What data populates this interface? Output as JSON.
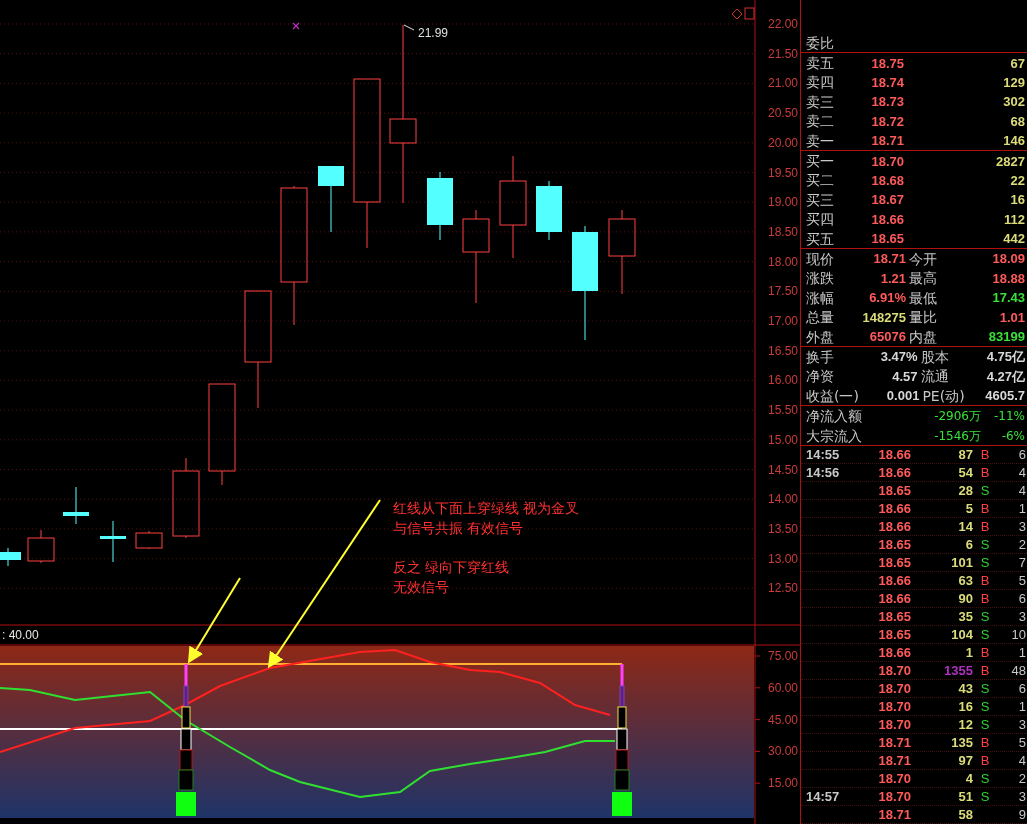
{
  "chart": {
    "high_label": "21.99",
    "price_axis": [
      "22.00",
      "21.50",
      "21.00",
      "20.50",
      "20.00",
      "19.50",
      "19.00",
      "18.50",
      "18.00",
      "17.50",
      "17.00",
      "16.50",
      "16.00",
      "15.50",
      "15.00",
      "14.50",
      "14.00",
      "13.50",
      "13.00",
      "12.50"
    ],
    "annotation": [
      "红线从下面上穿绿线 视为金叉",
      "与信号共振  有效信号",
      "反之 绿向下穿红线",
      "无效信号"
    ]
  },
  "indicator": {
    "header": ": 40.00",
    "axis": [
      "75.00",
      "60.00",
      "45.00",
      "30.00",
      "15.00"
    ]
  },
  "quote": {
    "ratio_label": "委比",
    "asks": [
      {
        "label": "卖五",
        "price": "18.75",
        "volume": "67"
      },
      {
        "label": "卖四",
        "price": "18.74",
        "volume": "129"
      },
      {
        "label": "卖三",
        "price": "18.73",
        "volume": "302"
      },
      {
        "label": "卖二",
        "price": "18.72",
        "volume": "68"
      },
      {
        "label": "卖一",
        "price": "18.71",
        "volume": "146"
      }
    ],
    "bids": [
      {
        "label": "买一",
        "price": "18.70",
        "volume": "2827"
      },
      {
        "label": "买二",
        "price": "18.68",
        "volume": "22"
      },
      {
        "label": "买三",
        "price": "18.67",
        "volume": "16"
      },
      {
        "label": "买四",
        "price": "18.66",
        "volume": "112"
      },
      {
        "label": "买五",
        "price": "18.65",
        "volume": "442"
      }
    ],
    "stats": [
      [
        {
          "label": "现价",
          "value": "18.71",
          "color": "#ff5a5a"
        },
        {
          "label": "今开",
          "value": "18.09",
          "color": "#ff5a5a"
        }
      ],
      [
        {
          "label": "涨跌",
          "value": "1.21",
          "color": "#ff5a5a"
        },
        {
          "label": "最高",
          "value": "18.88",
          "color": "#ff5a5a"
        }
      ],
      [
        {
          "label": "涨幅",
          "value": "6.91%",
          "color": "#ff5a5a"
        },
        {
          "label": "最低",
          "value": "17.43",
          "color": "#3ae03a"
        }
      ],
      [
        {
          "label": "总量",
          "value": "148275",
          "color": "#dcdc7a"
        },
        {
          "label": "量比",
          "value": "1.01",
          "color": "#ff5a5a"
        }
      ],
      [
        {
          "label": "外盘",
          "value": "65076",
          "color": "#ff5a5a"
        },
        {
          "label": "内盘",
          "value": "83199",
          "color": "#3ae03a"
        }
      ]
    ],
    "finance": [
      [
        {
          "label": "换手",
          "value": "3.47%"
        },
        {
          "label": "股本",
          "value": "4.75亿"
        }
      ],
      [
        {
          "label": "净资",
          "value": "4.57"
        },
        {
          "label": "流通",
          "value": "4.27亿"
        }
      ],
      [
        {
          "label": "收益(一)",
          "value": "0.001"
        },
        {
          "label": "PE(动)",
          "value": "4605.7"
        }
      ]
    ],
    "flows": [
      {
        "label": "净流入额",
        "amount": "-2906万",
        "percent": "-11%"
      },
      {
        "label": "大宗流入",
        "amount": "-1546万",
        "percent": "-6%"
      }
    ]
  },
  "trades": [
    {
      "time": "14:55",
      "price": "18.66",
      "volume": "87",
      "side": "B",
      "kind": "buy",
      "count": "6",
      "highlight": false
    },
    {
      "time": "14:56",
      "price": "18.66",
      "volume": "54",
      "side": "B",
      "kind": "buy",
      "count": "4",
      "highlight": false
    },
    {
      "price": "18.65",
      "volume": "28",
      "side": "S",
      "kind": "sell",
      "count": "4",
      "highlight": false
    },
    {
      "price": "18.66",
      "volume": "5",
      "side": "B",
      "kind": "buy",
      "count": "1",
      "highlight": false
    },
    {
      "price": "18.66",
      "volume": "14",
      "side": "B",
      "kind": "buy",
      "count": "3",
      "highlight": false
    },
    {
      "price": "18.65",
      "volume": "6",
      "side": "S",
      "kind": "sell",
      "count": "2",
      "highlight": false
    },
    {
      "price": "18.65",
      "volume": "101",
      "side": "S",
      "kind": "sell",
      "count": "7",
      "highlight": false
    },
    {
      "price": "18.66",
      "volume": "63",
      "side": "B",
      "kind": "buy",
      "count": "5",
      "highlight": false
    },
    {
      "price": "18.66",
      "volume": "90",
      "side": "B",
      "kind": "buy",
      "count": "6",
      "highlight": false
    },
    {
      "price": "18.65",
      "volume": "35",
      "side": "S",
      "kind": "sell",
      "count": "3",
      "highlight": false
    },
    {
      "price": "18.65",
      "volume": "104",
      "side": "S",
      "kind": "sell",
      "count": "10",
      "highlight": false
    },
    {
      "price": "18.66",
      "volume": "1",
      "side": "B",
      "kind": "buy",
      "count": "1",
      "highlight": false
    },
    {
      "price": "18.70",
      "volume": "1355",
      "side": "B",
      "kind": "buy",
      "count": "48",
      "highlight": true
    },
    {
      "price": "18.70",
      "volume": "43",
      "side": "S",
      "kind": "sell",
      "count": "6",
      "highlight": false
    },
    {
      "price": "18.70",
      "volume": "16",
      "side": "S",
      "kind": "sell",
      "count": "1",
      "highlight": false
    },
    {
      "price": "18.70",
      "volume": "12",
      "side": "S",
      "kind": "sell",
      "count": "3",
      "highlight": false
    },
    {
      "price": "18.71",
      "volume": "135",
      "side": "B",
      "kind": "buy",
      "count": "5",
      "highlight": false
    },
    {
      "price": "18.71",
      "volume": "97",
      "side": "B",
      "kind": "buy",
      "count": "4",
      "highlight": false
    },
    {
      "price": "18.70",
      "volume": "4",
      "side": "S",
      "kind": "sell",
      "count": "2",
      "highlight": false
    },
    {
      "time": "14:57",
      "price": "18.70",
      "volume": "51",
      "side": "S",
      "kind": "sell",
      "count": "3",
      "highlight": false
    },
    {
      "price": "18.71",
      "volume": "58",
      "count": "9",
      "highlight": false
    }
  ]
}
